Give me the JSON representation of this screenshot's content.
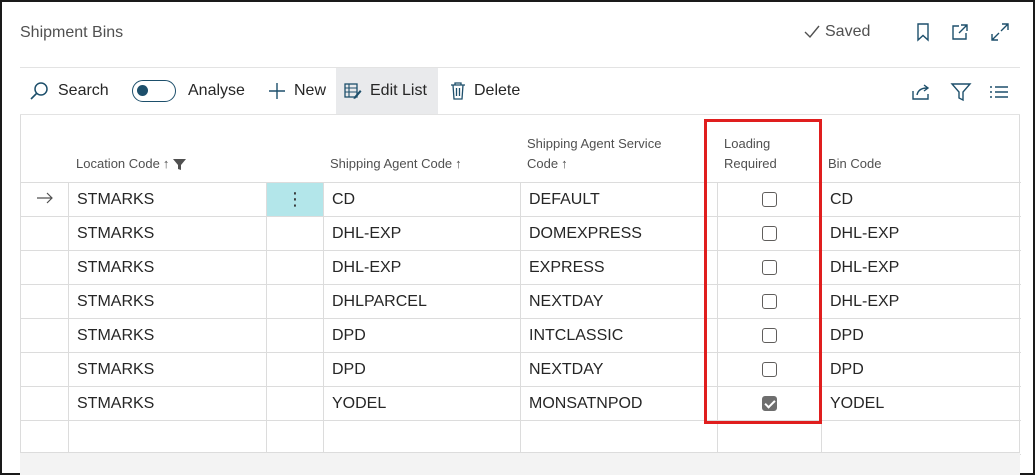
{
  "page": {
    "title": "Shipment Bins",
    "saved_label": "Saved"
  },
  "toolbar": {
    "search": "Search",
    "analyse": "Analyse",
    "new": "New",
    "edit_list": "Edit List",
    "delete": "Delete"
  },
  "grid": {
    "columns": {
      "location_code": "Location Code",
      "shipping_agent_code": "Shipping Agent Code",
      "service_code_line1": "Shipping Agent Service",
      "service_code_line2": "Code",
      "loading_line1": "Loading",
      "loading_line2": "Required",
      "bin_code": "Bin Code"
    },
    "rows": [
      {
        "location": "STMARKS",
        "agent": "CD",
        "service": "DEFAULT",
        "loading": false,
        "bin": "CD"
      },
      {
        "location": "STMARKS",
        "agent": "DHL-EXP",
        "service": "DOMEXPRESS",
        "loading": false,
        "bin": "DHL-EXP"
      },
      {
        "location": "STMARKS",
        "agent": "DHL-EXP",
        "service": "EXPRESS",
        "loading": false,
        "bin": "DHL-EXP"
      },
      {
        "location": "STMARKS",
        "agent": "DHLPARCEL",
        "service": "NEXTDAY",
        "loading": false,
        "bin": "DHL-EXP"
      },
      {
        "location": "STMARKS",
        "agent": "DPD",
        "service": "INTCLASSIC",
        "loading": false,
        "bin": "DPD"
      },
      {
        "location": "STMARKS",
        "agent": "DPD",
        "service": "NEXTDAY",
        "loading": false,
        "bin": "DPD"
      },
      {
        "location": "STMARKS",
        "agent": "YODEL",
        "service": "MONSATNPOD",
        "loading": true,
        "bin": "YODEL"
      }
    ]
  },
  "colors": {
    "accent": "#1d4f6b",
    "highlight": "#e01e1e",
    "selected_cell": "#b3e6ea"
  }
}
